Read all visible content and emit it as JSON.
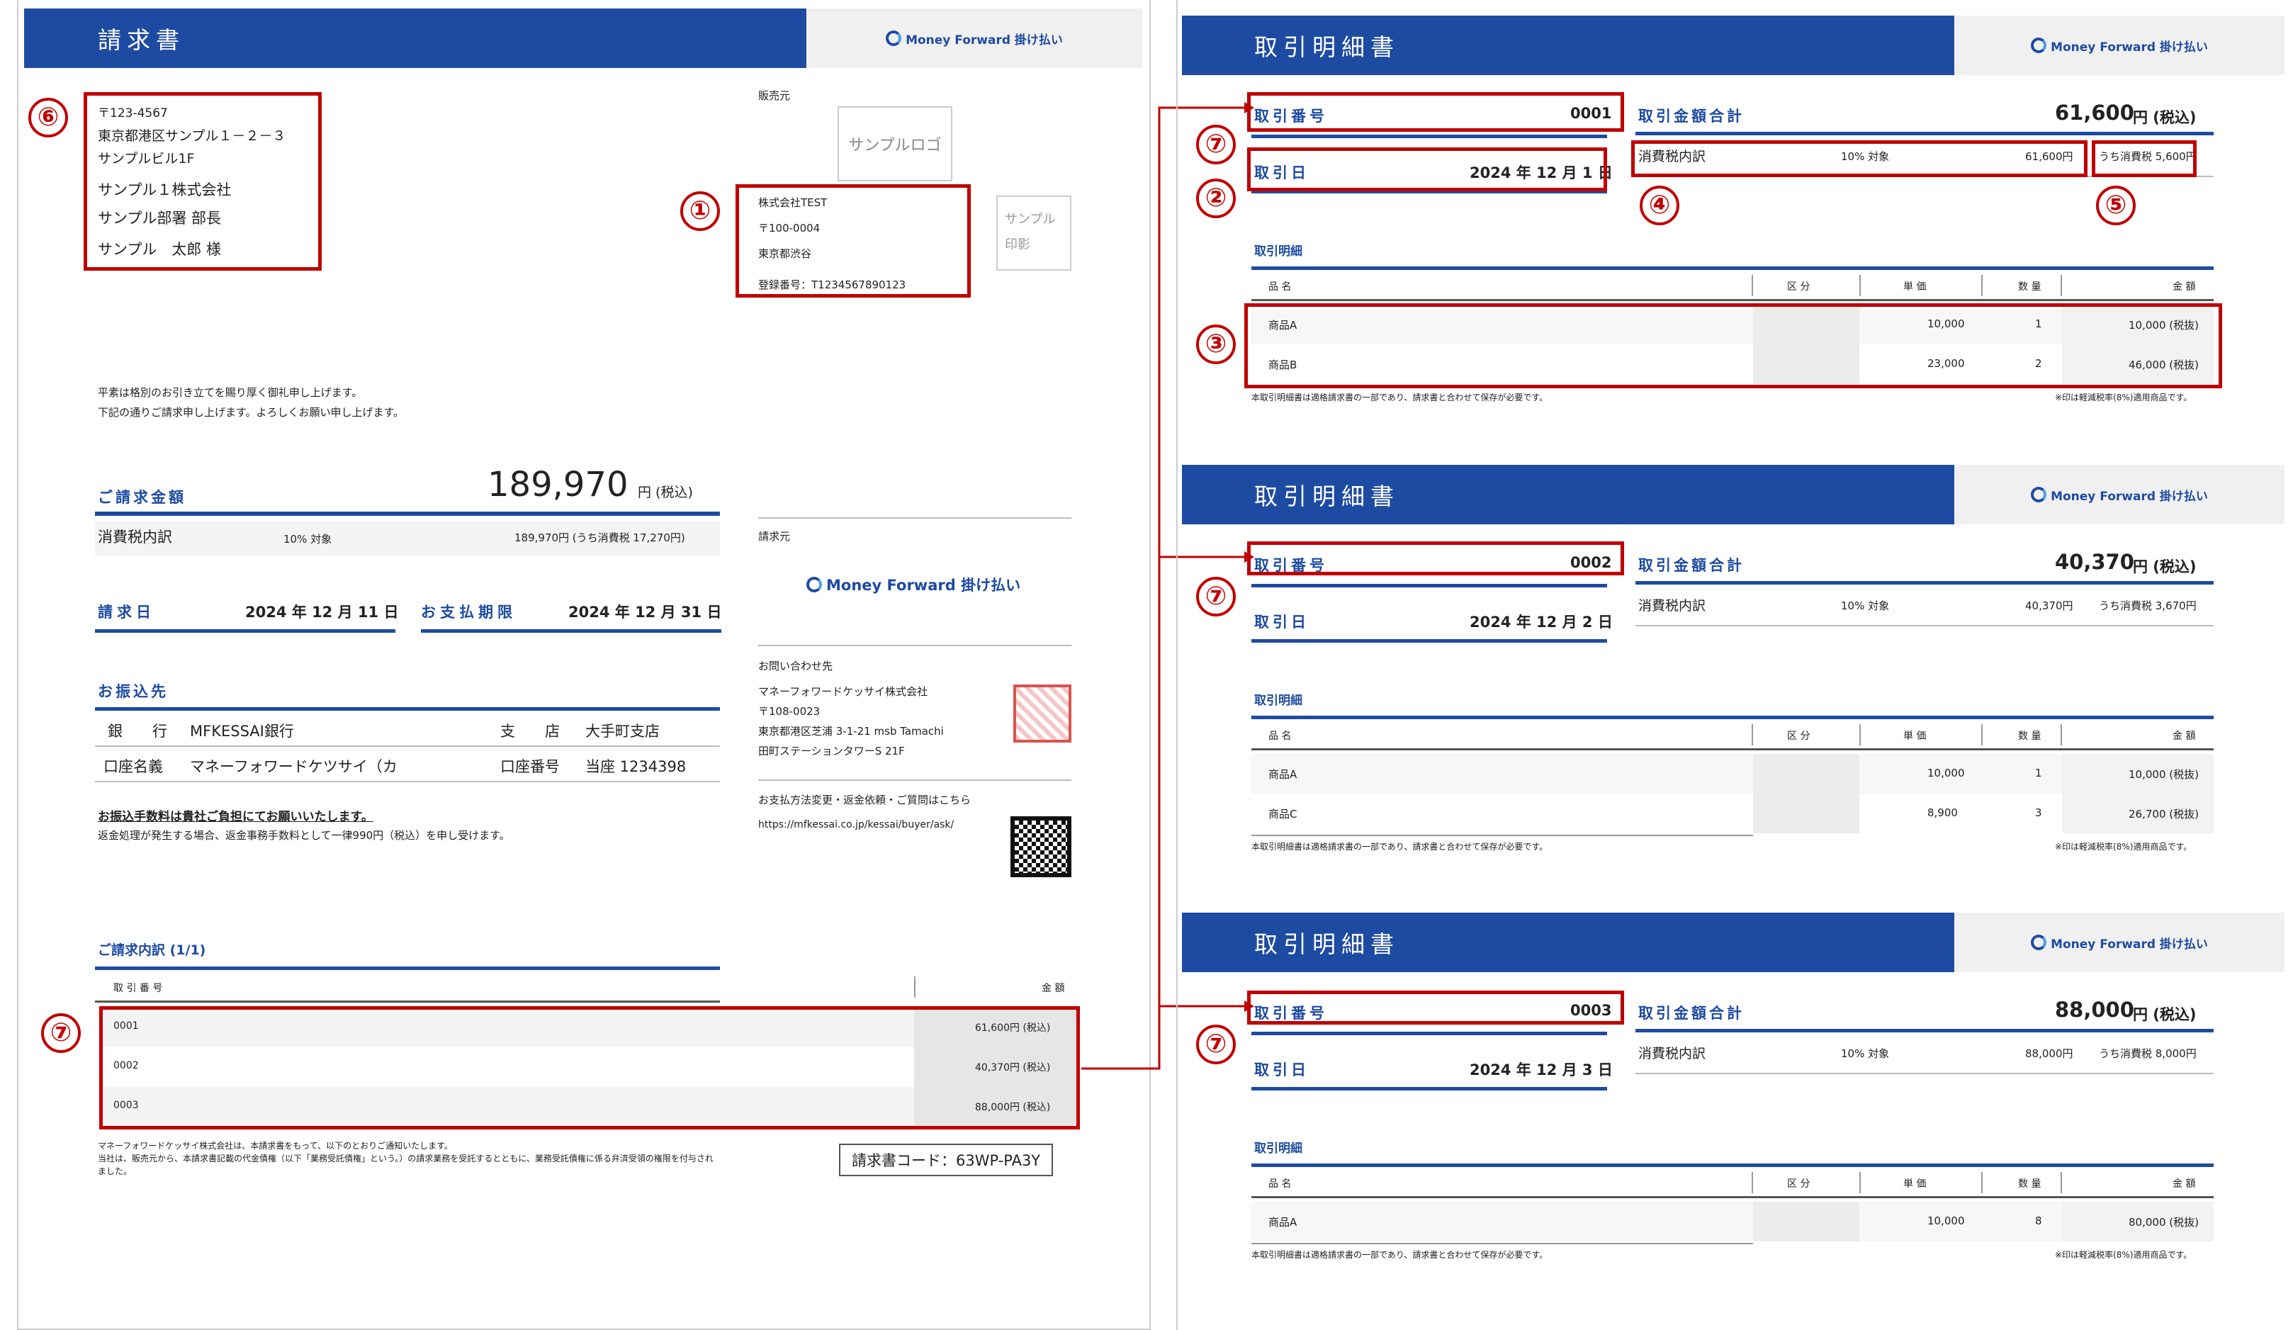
{
  "invoice": {
    "title": "請求書",
    "brand": "Money Forward 掛け払い",
    "address_postal": "〒123-4567",
    "address_line1": "東京都港区サンプル１－２－３",
    "address_line2": "サンプルビル1F",
    "company": "サンプル１株式会社",
    "dept": "サンプル部署 部長",
    "person": "サンプル　太郎 様",
    "seller_label": "販売元",
    "sample_logo": "サンプルロゴ",
    "seller_company": "株式会社TEST",
    "seller_postal": "〒100-0004",
    "seller_city": "東京都渋谷",
    "seller_reg": "登録番号：T1234567890123",
    "seal_text_1": "サンプル",
    "seal_text_2": "印影",
    "greeting_1": "平素は格別のお引き立てを賜り厚く御礼申し上げます。",
    "greeting_2": "下記の通りご請求申し上げます。よろしくお願い申し上げます。",
    "amount_label": "ご請求金額",
    "amount_value": "189,970",
    "amount_unit": "円 (税込)",
    "tax_label": "消費税内訳",
    "tax_rate": "10% 対象",
    "tax_detail": "189,970円 (うち消費税 17,270円)",
    "invoice_date_label": "請求日",
    "invoice_date": "2024 年 12 月 11 日",
    "due_label": "お支払期限",
    "due_date": "2024 年 12 月 31 日",
    "transfer_label": "お振込先",
    "bank_label": "銀　　行",
    "bank_value": "MFKESSAI銀行",
    "branch_label": "支　　店",
    "branch_value": "大手町支店",
    "acct_name_label": "口座名義",
    "acct_name_value": "マネーフォワードケツサイ（カ",
    "acct_no_label": "口座番号",
    "acct_no_value": "当座 1234398",
    "fee_note_1": "お振込手数料は貴社ご負担にてお願いいたします。",
    "fee_note_2": "返金処理が発生する場合、返金事務手数料として一律990円（税込）を申し受けます。",
    "billing_from_label": "請求元",
    "contact_label": "お問い合わせ先",
    "contact_company": "マネーフォワードケッサイ株式会社",
    "contact_postal": "〒108-0023",
    "contact_addr1": "東京都港区芝浦 3-1-21 msb Tamachi",
    "contact_addr2": "田町ステーションタワーS 21F",
    "change_label": "お支払方法変更・返金依頼・ご質問はこちら",
    "change_url": "https://mfkessai.co.jp/kessai/buyer/ask/",
    "breakdown_label": "ご請求内訳 (1/1)",
    "col_txn": "取 引 番 号",
    "col_amount": "金 額",
    "rows": [
      {
        "no": "0001",
        "amount": "61,600円 (税込)"
      },
      {
        "no": "0002",
        "amount": "40,370円 (税込)"
      },
      {
        "no": "0003",
        "amount": "88,000円 (税込)"
      }
    ],
    "footer_1": "マネーフォワードケッサイ株式会社は、本請求書をもって、以下のとおりご通知いたします。",
    "footer_2": "当社は、販売元から、本請求書記載の代金債権（以下「業務受託債権」という。）の請求業務を受託するとともに、業務受託債権に係る弁済受領の権限を付与され",
    "footer_3": "ました。",
    "code": "請求書コード：63WP-PA3Y"
  },
  "statements": [
    {
      "title": "取引明細書",
      "brand": "Money Forward 掛け払い",
      "txn_label": "取引番号",
      "txn_no": "0001",
      "date_label": "取引日",
      "date": "2024 年 12 月 1 日",
      "total_label": "取引金額合計",
      "total": "61,600",
      "total_unit": "円 (税込)",
      "tax_label": "消費税内訳",
      "tax_rate": "10% 対象",
      "tax_amount": "61,600円",
      "tax_incl": "うち消費税 5,600円",
      "detail_label": "取引明細",
      "headers": [
        "品 名",
        "区 分",
        "単 価",
        "数 量",
        "金 額"
      ],
      "items": [
        {
          "name": "商品A",
          "price": "10,000",
          "qty": "1",
          "amount": "10,000 (税抜)"
        },
        {
          "name": "商品B",
          "price": "23,000",
          "qty": "2",
          "amount": "46,000 (税抜)"
        }
      ],
      "note_left": "本取引明細書は適格請求書の一部であり、請求書と合わせて保存が必要です。",
      "note_right": "※印は軽減税率(8%)適用商品です。"
    },
    {
      "title": "取引明細書",
      "brand": "Money Forward 掛け払い",
      "txn_label": "取引番号",
      "txn_no": "0002",
      "date_label": "取引日",
      "date": "2024 年 12 月 2 日",
      "total_label": "取引金額合計",
      "total": "40,370",
      "total_unit": "円 (税込)",
      "tax_label": "消費税内訳",
      "tax_rate": "10% 対象",
      "tax_amount": "40,370円",
      "tax_incl": "うち消費税 3,670円",
      "detail_label": "取引明細",
      "headers": [
        "品 名",
        "区 分",
        "単 価",
        "数 量",
        "金 額"
      ],
      "items": [
        {
          "name": "商品A",
          "price": "10,000",
          "qty": "1",
          "amount": "10,000 (税抜)"
        },
        {
          "name": "商品C",
          "price": "8,900",
          "qty": "3",
          "amount": "26,700 (税抜)"
        }
      ],
      "note_left": "本取引明細書は適格請求書の一部であり、請求書と合わせて保存が必要です。",
      "note_right": "※印は軽減税率(8%)適用商品です。"
    },
    {
      "title": "取引明細書",
      "brand": "Money Forward 掛け払い",
      "txn_label": "取引番号",
      "txn_no": "0003",
      "date_label": "取引日",
      "date": "2024 年 12 月 3 日",
      "total_label": "取引金額合計",
      "total": "88,000",
      "total_unit": "円 (税込)",
      "tax_label": "消費税内訳",
      "tax_rate": "10% 対象",
      "tax_amount": "88,000円",
      "tax_incl": "うち消費税 8,000円",
      "detail_label": "取引明細",
      "headers": [
        "品 名",
        "区 分",
        "単 価",
        "数 量",
        "金 額"
      ],
      "items": [
        {
          "name": "商品A",
          "price": "10,000",
          "qty": "8",
          "amount": "80,000 (税抜)"
        }
      ],
      "note_left": "本取引明細書は適格請求書の一部であり、請求書と合わせて保存が必要です。",
      "note_right": "※印は軽減税率(8%)適用商品です。"
    }
  ],
  "markers": {
    "m1": "①",
    "m2": "②",
    "m3": "③",
    "m4": "④",
    "m5": "⑤",
    "m6": "⑥",
    "m7": "⑦"
  },
  "colors": {
    "accent": "#1e4ba2",
    "highlight": "#c00000"
  }
}
